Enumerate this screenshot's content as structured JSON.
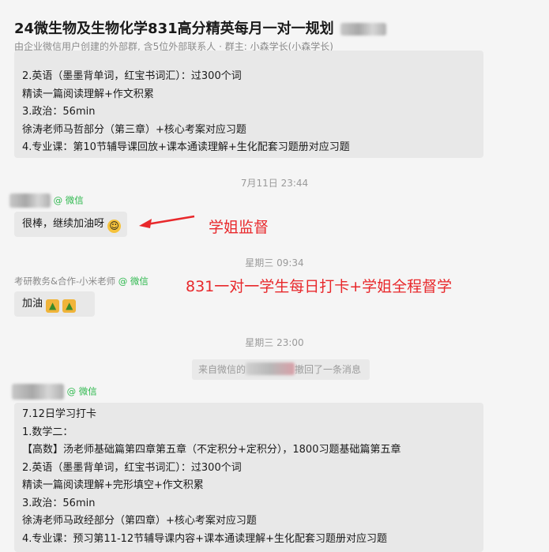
{
  "chat": {
    "title": "24微生物及生物化学831高分精英每月一对一规划",
    "subtitle": "由企业微信用户创建的外部群, 含5位外部联系人 · 群主: 小森学长(小森学长)"
  },
  "messages": {
    "first": {
      "lines": [
        "2.英语（墨墨背单词，红宝书词汇）：过300个词",
        "精读一篇阅读理解+作文积累",
        "3.政治：56min",
        "徐涛老师马哲部分（第三章）+核心考案对应习题",
        "4.专业课：第10节辅导课回放+课本通读理解+生化配套习题册对应习题"
      ]
    },
    "time1": "7月11日 23:44",
    "sender1_suffix": "@ 微信",
    "msg1": "很棒，继续加油呀",
    "time2": "星期三 09:34",
    "sender2": "考研教务&合作-小米老师",
    "sender2_suffix": "@ 微信",
    "msg2": "加油",
    "time3": "星期三 23:00",
    "recall": {
      "prefix": "来自微信的",
      "suffix": "撤回了一条消息"
    },
    "sender3_suffix": "@ 微信",
    "last": {
      "lines": [
        "7.12日学习打卡",
        "1.数学二：",
        "【高数】汤老师基础篇第四章第五章（不定积分+定积分），1800习题基础篇第五章",
        "2.英语（墨墨背单词，红宝书词汇）：过300个词",
        "精读一篇阅读理解+完形填空+作文积累",
        "3.政治：56min",
        "徐涛老师马政经部分（第四章）+核心考案对应习题",
        "4.专业课：预习第11-12节辅导课内容+课本通读理解+生化配套习题册对应习题"
      ]
    }
  },
  "annotations": {
    "a1": "学姐监督",
    "a2": "831一对一学生每日打卡+学姐全程督学"
  },
  "colors": {
    "annotation": "#e8282b",
    "wechat_suffix": "#2db84d",
    "bubble": "#e8e8e8"
  }
}
